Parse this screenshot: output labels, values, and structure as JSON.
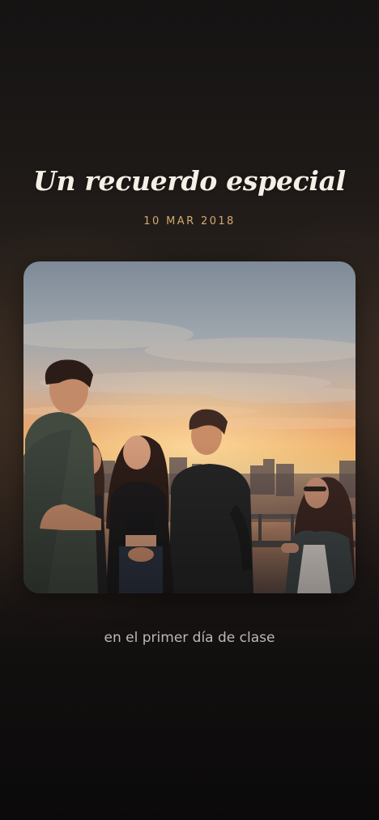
{
  "memory": {
    "title": "Un recuerdo especial",
    "date": "10 MAR 2018",
    "caption": "en el primer día de clase"
  },
  "colors": {
    "background": "#1d1917",
    "title": "#f6efe6",
    "date_accent": "#d3a96e",
    "caption": "#bdb8b3"
  }
}
